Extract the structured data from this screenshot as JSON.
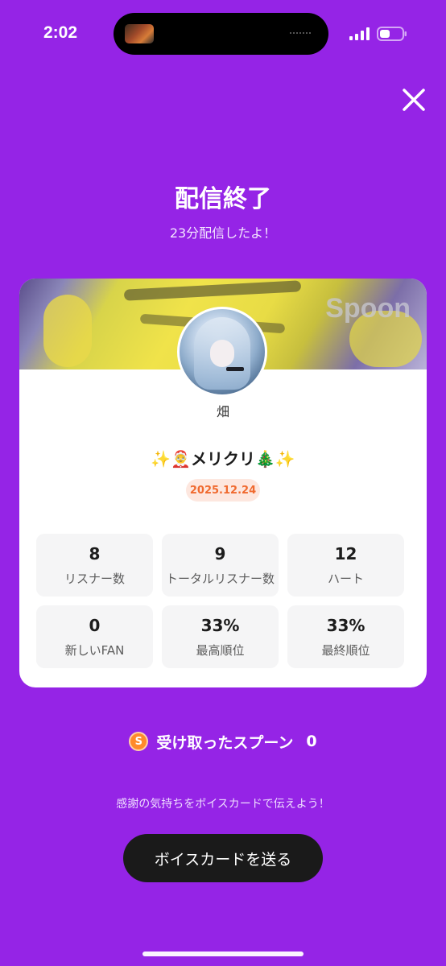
{
  "status_bar": {
    "time": "2:02"
  },
  "header": {
    "title": "配信終了",
    "subtitle": "23分配信したよ！"
  },
  "card": {
    "banner_logo": "Spoon",
    "username": "畑",
    "live_title": "✨🤶メリクリ🎄✨",
    "date": "2025.12.24",
    "stats": [
      {
        "value": "8",
        "label": "リスナー数"
      },
      {
        "value": "9",
        "label": "トータルリスナー数"
      },
      {
        "value": "12",
        "label": "ハート"
      },
      {
        "value": "0",
        "label": "新しいFAN"
      },
      {
        "value": "33%",
        "label": "最高順位"
      },
      {
        "value": "33%",
        "label": "最終順位"
      }
    ]
  },
  "spoons": {
    "icon_text": "S",
    "label": "受け取ったスプーン",
    "count": "0"
  },
  "footer": {
    "thanks_text": "感謝の気持ちをボイスカードで伝えよう！",
    "voice_card_button": "ボイスカードを送る"
  },
  "colors": {
    "background": "#9524e6",
    "accent": "#f06a2f",
    "button": "#1a1a1a"
  },
  "icons": {
    "close": "close-icon",
    "spoon": "spoon-coin-icon"
  }
}
